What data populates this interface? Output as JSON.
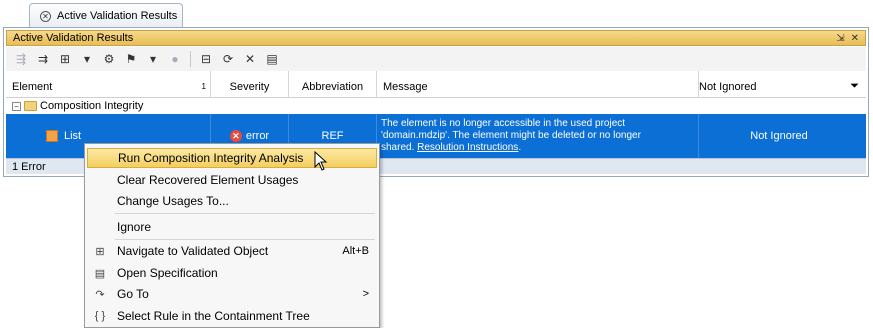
{
  "tab": {
    "title": "Active Validation Results"
  },
  "panel": {
    "title": "Active Validation Results"
  },
  "table": {
    "columns": [
      "Element",
      "Severity",
      "Abbreviation",
      "Message",
      "Not Ignored"
    ],
    "sort_indicator": "1",
    "group": {
      "label": "Composition Integrity"
    },
    "row": {
      "element": "List",
      "severity": "error",
      "abbreviation": "REF",
      "message_line1": "The element is no longer accessible in the used project",
      "message_line2": "'domain.mdzip'. The element might be deleted or no longer",
      "message_line3_prefix": "shared. ",
      "message_link": "Resolution Instructions",
      "message_suffix": ".",
      "not_ignored": "Not Ignored"
    }
  },
  "status": {
    "text": "1 Error"
  },
  "menu": {
    "items": [
      {
        "label": "Run Composition Integrity Analysis",
        "icon": ""
      },
      {
        "label": "Clear Recovered Element Usages",
        "icon": ""
      },
      {
        "label": "Change Usages To...",
        "icon": ""
      },
      {
        "label": "Ignore",
        "icon": ""
      },
      {
        "label": "Navigate to Validated Object",
        "icon": "navigate-icon",
        "accel": "Alt+B"
      },
      {
        "label": "Open Specification",
        "icon": "specification-icon"
      },
      {
        "label": "Go To",
        "icon": "goto-icon",
        "submenu": ">"
      },
      {
        "label": "Select Rule in the Containment Tree",
        "icon": "braces-icon"
      }
    ]
  },
  "colors": {
    "selection": "#0b6fd6",
    "highlight": "#f4cf5e",
    "titlebar": "#e8be55",
    "error": "#e84b3c"
  }
}
